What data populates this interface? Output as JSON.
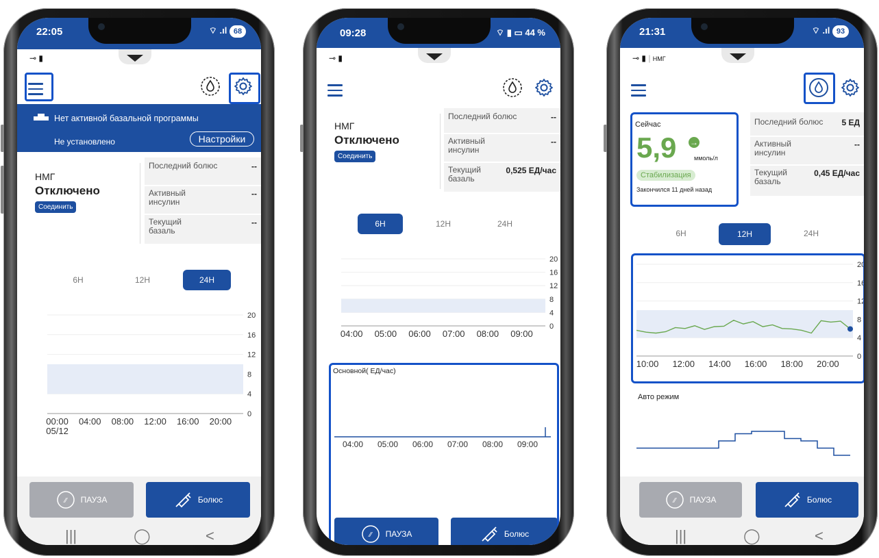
{
  "phones": [
    {
      "status_time": "22:05",
      "status_battery": "68",
      "menu_label": "menu",
      "banner": {
        "title": "Нет активной базальной программы",
        "subtitle": "Не установлено",
        "settings_button": "Настройки"
      },
      "cgm": {
        "name": "НМГ",
        "state": "Отключено",
        "connect": "Соединить"
      },
      "info": [
        {
          "label": "Последний болюс",
          "value": "--"
        },
        {
          "label": "Активный инсулин",
          "value": "--"
        },
        {
          "label": "Текущий базаль",
          "value": "--"
        }
      ],
      "ranges": [
        "6H",
        "12H",
        "24H"
      ],
      "active_range": "24H",
      "chart_data": {
        "type": "line",
        "x": [
          "00:00",
          "04:00",
          "08:00",
          "12:00",
          "16:00",
          "20:00"
        ],
        "x_sublabel": "05/12",
        "y_ticks": [
          0,
          4,
          8,
          12,
          16,
          20
        ],
        "target_range": [
          4,
          10
        ],
        "ylim": [
          0,
          20
        ],
        "values": []
      },
      "buttons": {
        "pause": "ПАУЗА",
        "bolus": "Болюс"
      }
    },
    {
      "status_time": "09:28",
      "status_battery": "44 %",
      "cgm": {
        "name": "НМГ",
        "state": "Отключено",
        "connect": "Соединить"
      },
      "info": [
        {
          "label": "Последний болюс",
          "value": "--"
        },
        {
          "label": "Активный инсулин",
          "value": "--"
        },
        {
          "label": "Текущий базаль",
          "value": "0,525 ЕД/час"
        }
      ],
      "ranges": [
        "6H",
        "12H",
        "24H"
      ],
      "active_range": "6H",
      "chart_data": {
        "type": "line",
        "x": [
          "04:00",
          "05:00",
          "06:00",
          "07:00",
          "08:00",
          "09:00"
        ],
        "y_ticks": [
          0,
          4,
          8,
          12,
          16,
          20
        ],
        "target_range": [
          4,
          8
        ],
        "ylim": [
          0,
          20
        ],
        "values": []
      },
      "basal_title": "Основной( ЕД/час)",
      "basal_x": [
        "04:00",
        "05:00",
        "06:00",
        "07:00",
        "08:00",
        "09:00"
      ],
      "buttons": {
        "pause": "ПАУЗА",
        "bolus": "Болюс"
      }
    },
    {
      "status_time": "21:31",
      "status_battery": "93",
      "sys_label": "НМГ",
      "now": {
        "title": "Сейчас",
        "value": "5,9",
        "unit": "ммоль/л",
        "trend": "stable",
        "status": "Стабилизация",
        "ended": "Закончился 11 дней назад"
      },
      "info": [
        {
          "label": "Последний болюс",
          "value": "5 ЕД"
        },
        {
          "label": "Активный инсулин",
          "value": "--"
        },
        {
          "label": "Текущий базаль",
          "value": "0,45 ЕД/час"
        }
      ],
      "ranges": [
        "6H",
        "12H",
        "24H"
      ],
      "active_range": "12H",
      "chart_data": {
        "type": "line",
        "x": [
          "10:00",
          "12:00",
          "14:00",
          "16:00",
          "18:00",
          "20:00"
        ],
        "y_ticks": [
          0,
          4,
          8,
          12,
          16,
          20
        ],
        "target_range": [
          4,
          10
        ],
        "ylim": [
          0,
          20
        ],
        "series": [
          {
            "values": [
              5.6,
              5.2,
              5.0,
              5.3,
              6.2,
              6.0,
              6.6,
              5.8,
              6.4,
              6.5,
              7.8,
              7.0,
              7.5,
              6.4,
              6.8,
              6.0,
              5.9,
              5.6,
              5.0,
              7.7,
              7.4,
              7.6,
              5.9
            ]
          }
        ]
      },
      "auto_mode_label": "Авто режим",
      "auto_x": [
        "10:00",
        "12:00",
        "14:00",
        "16:00",
        "18:00",
        "20:00"
      ],
      "auto_values": [
        0.45,
        0.45,
        0.45,
        0.45,
        0.45,
        0.6,
        0.75,
        0.8,
        0.8,
        0.65,
        0.6,
        0.45,
        0.3
      ],
      "buttons": {
        "pause": "ПАУЗА",
        "bolus": "Болюс"
      }
    }
  ],
  "colors": {
    "brand": "#1d4fa0",
    "highlight": "#1452c8",
    "glucose": "#6aa84f",
    "target": "#e6ecf7"
  }
}
